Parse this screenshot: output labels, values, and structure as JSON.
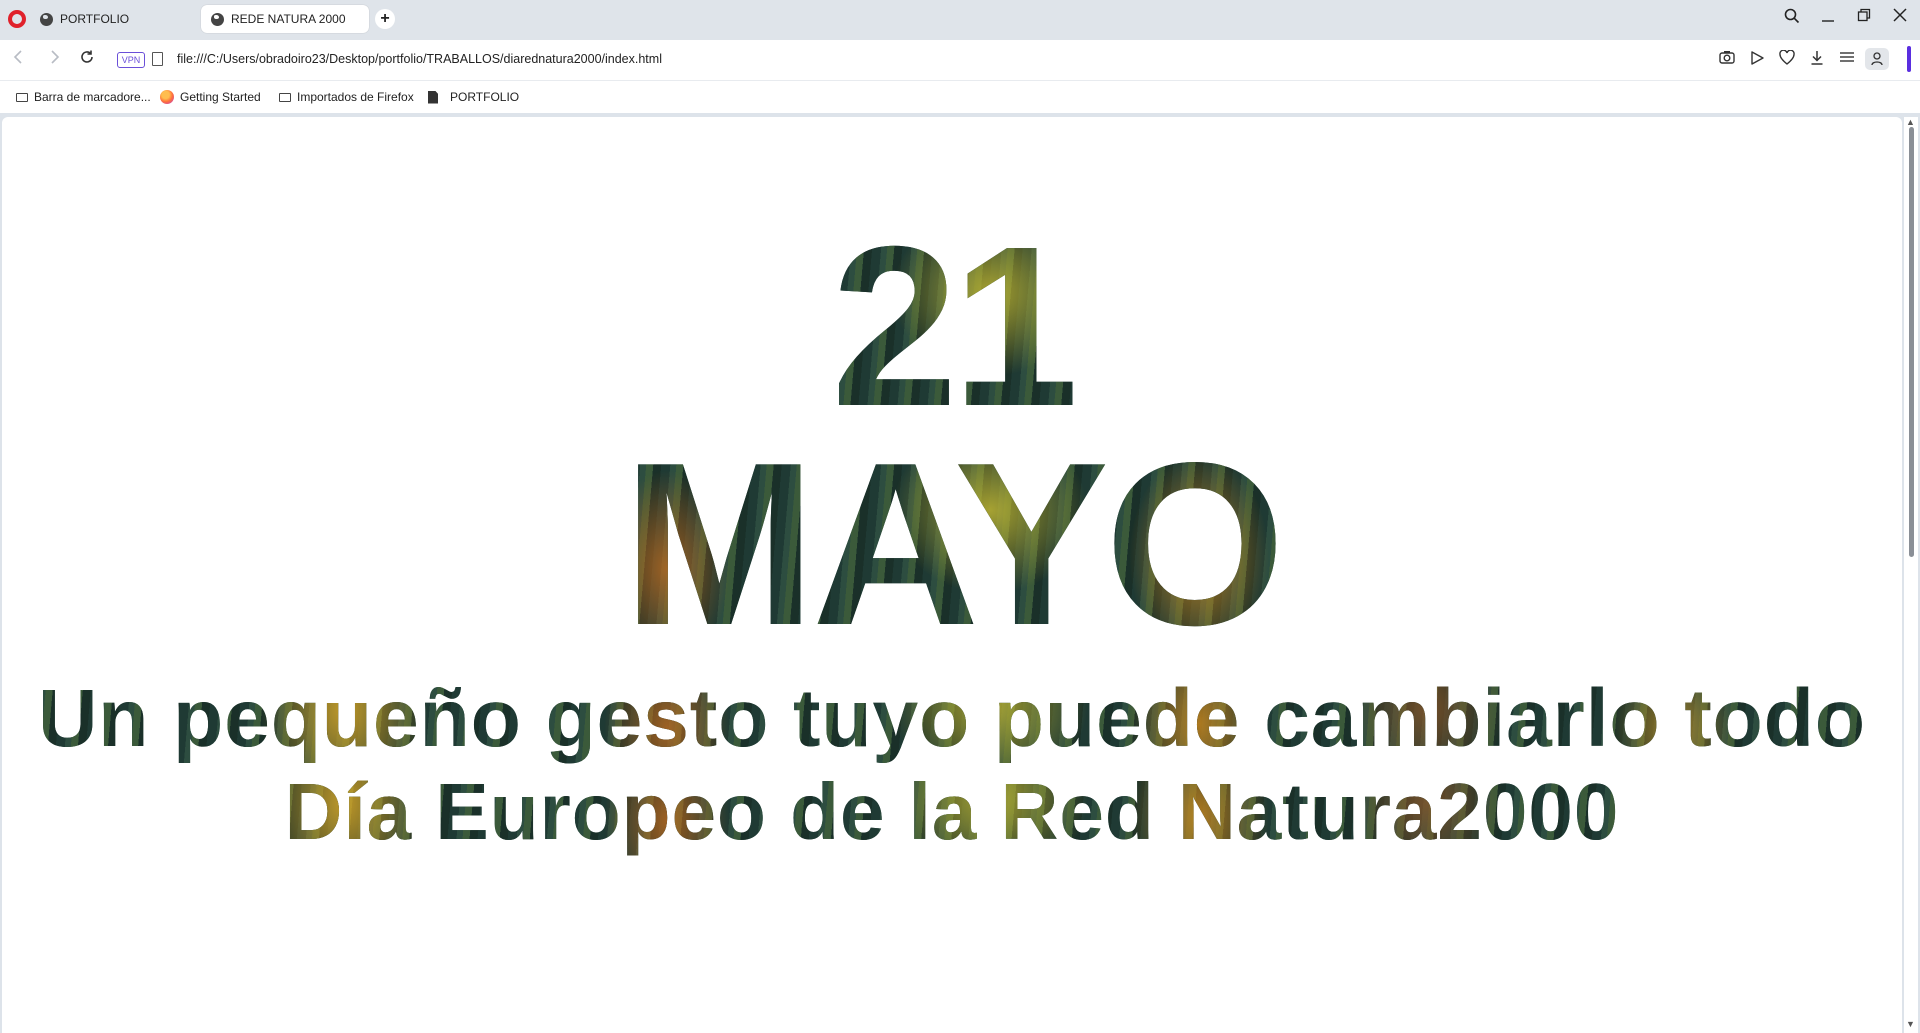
{
  "browser": {
    "tabs": [
      {
        "label": "PORTFOLIO",
        "active": false
      },
      {
        "label": "REDE NATURA 2000",
        "active": true
      }
    ],
    "new_tab_label": "+",
    "url": "file:///C:/Users/obradoiro23/Desktop/portfolio/TRABALLOS/diarednatura2000/index.html",
    "vpn_label": "VPN",
    "accent_color": "#5a2ee0",
    "bookmarks": [
      {
        "label": "Barra de marcadore...",
        "icon": "folder-icon"
      },
      {
        "label": "Getting Started",
        "icon": "firefox-icon"
      },
      {
        "label": "Importados de Firefox",
        "icon": "folder-icon"
      },
      {
        "label": "PORTFOLIO",
        "icon": "document-icon"
      }
    ]
  },
  "page": {
    "day": "21",
    "month": "MAYO",
    "tagline": "Un pequeño gesto tuyo puede cambiarlo todo",
    "subtitle": "Día Europeo de la Red Natura2000"
  }
}
